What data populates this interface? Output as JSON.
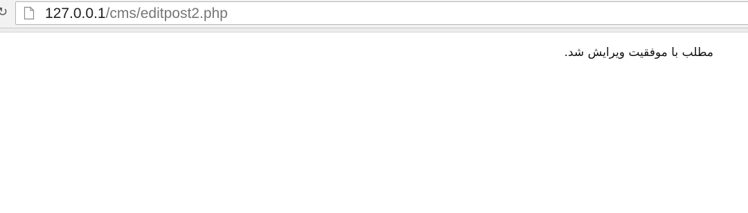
{
  "browser": {
    "address_bar": {
      "host": "127.0.0.1",
      "path": "/cms/editpost2.php",
      "page_icon": "page-icon"
    },
    "toolbar_icon": "reload-icon"
  },
  "page": {
    "message": "مطلب با موفقیت ویرایش شد."
  }
}
